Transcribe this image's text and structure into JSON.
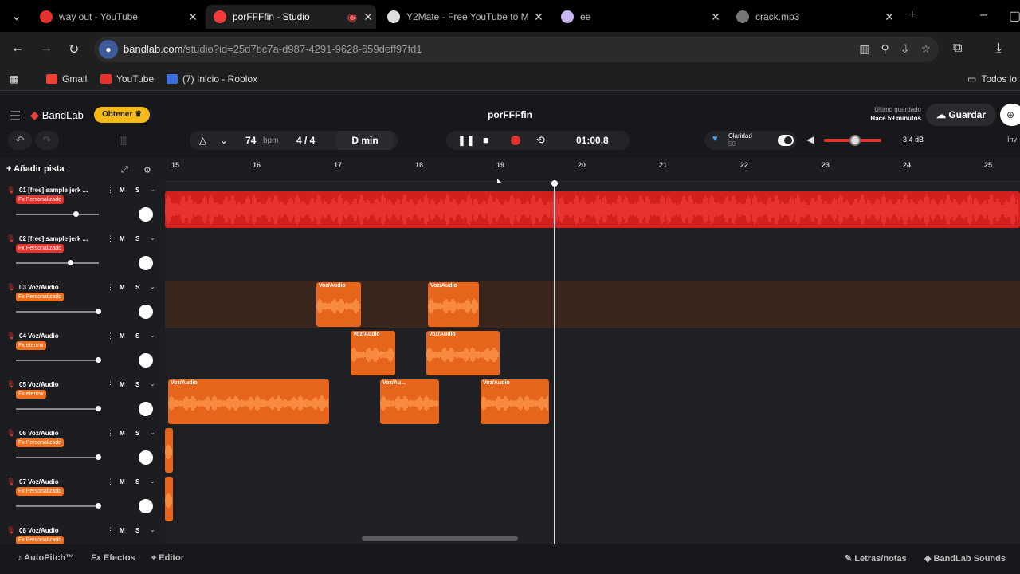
{
  "browser": {
    "tabs": [
      {
        "title": "way out - YouTube",
        "color": "#e5322d",
        "active": false
      },
      {
        "title": "porFFFfin - Studio",
        "color": "#f23c3c",
        "active": true
      },
      {
        "title": "Y2Mate - Free YouTube to M",
        "color": "#ffffff",
        "active": false
      },
      {
        "title": "ee",
        "color": "#c8b7f0",
        "active": false
      },
      {
        "title": "crack.mp3",
        "color": "#888888",
        "active": false
      }
    ],
    "url_host": "bandlab.com",
    "url_path": "/studio?id=25d7bc7a-d987-4291-9628-659deff97fd1",
    "bookmarks": [
      {
        "label": "Gmail",
        "color": "#ea4335"
      },
      {
        "label": "YouTube",
        "color": "#e5322d"
      },
      {
        "label": "(7) Inicio - Roblox",
        "color": "#3b6fe0"
      }
    ],
    "bookmarks_right": "Todos lo"
  },
  "header": {
    "logo": "BandLab",
    "obtener": "Obtener",
    "project_title": "porFFFfin",
    "saved_label": "Último guardado",
    "saved_time": "Hace 59 minutos",
    "guardar": "Guardar",
    "bpm": "74",
    "bpm_unit": "bpm",
    "meter": "4 / 4",
    "key": "D min",
    "time": "01:00.8",
    "clarity_label": "Claridad",
    "clarity_value": "50",
    "db": "-3.4 dB",
    "inv": "Inv"
  },
  "tracks_area": {
    "add_track": "Añadir pista",
    "ruler": [
      "15",
      "16",
      "17",
      "18",
      "19",
      "20",
      "21",
      "22",
      "23",
      "24",
      "25"
    ]
  },
  "tracks": [
    {
      "num": "01",
      "name": "[free] sample jerk ...",
      "fx": "Fx Personalizado",
      "volume": 0.72,
      "fx_color": "#e5322d"
    },
    {
      "num": "02",
      "name": "[free] sample jerk ...",
      "fx": "Fx Personalizado",
      "volume": 0.65,
      "fx_color": "#e5322d"
    },
    {
      "num": "03",
      "name": "Voz/Audio",
      "fx": "Fx Personalizado",
      "volume": 1.0,
      "fx_color": "#f0701d"
    },
    {
      "num": "04",
      "name": "Voz/Audio",
      "fx": "Fx eterrrw",
      "volume": 1.0,
      "fx_color": "#f0701d"
    },
    {
      "num": "05",
      "name": "Voz/Audio",
      "fx": "Fx eterrrw",
      "volume": 1.0,
      "fx_color": "#f0701d"
    },
    {
      "num": "06",
      "name": "Voz/Audio",
      "fx": "Fx Personalizado",
      "volume": 1.0,
      "fx_color": "#f0701d"
    },
    {
      "num": "07",
      "name": "Voz/Audio",
      "fx": "Fx Personalizado",
      "volume": 1.0,
      "fx_color": "#f0701d"
    },
    {
      "num": "08",
      "name": "Voz/Audio",
      "fx": "Fx Personalizado",
      "volume": 1.0,
      "fx_color": "#f0701d"
    }
  ],
  "clips": {
    "clip_label": "Voz/Audio",
    "clip_label_short": "Voz/Au..."
  },
  "footer": {
    "autopitch": "AutoPitch™",
    "efectos": "Efectos",
    "editor": "Editor",
    "letras": "Letras/notas",
    "sounds": "BandLab Sounds"
  },
  "colors": {
    "accent": "#e5322d",
    "orange": "#f0701d",
    "gold": "#f5b91a"
  }
}
